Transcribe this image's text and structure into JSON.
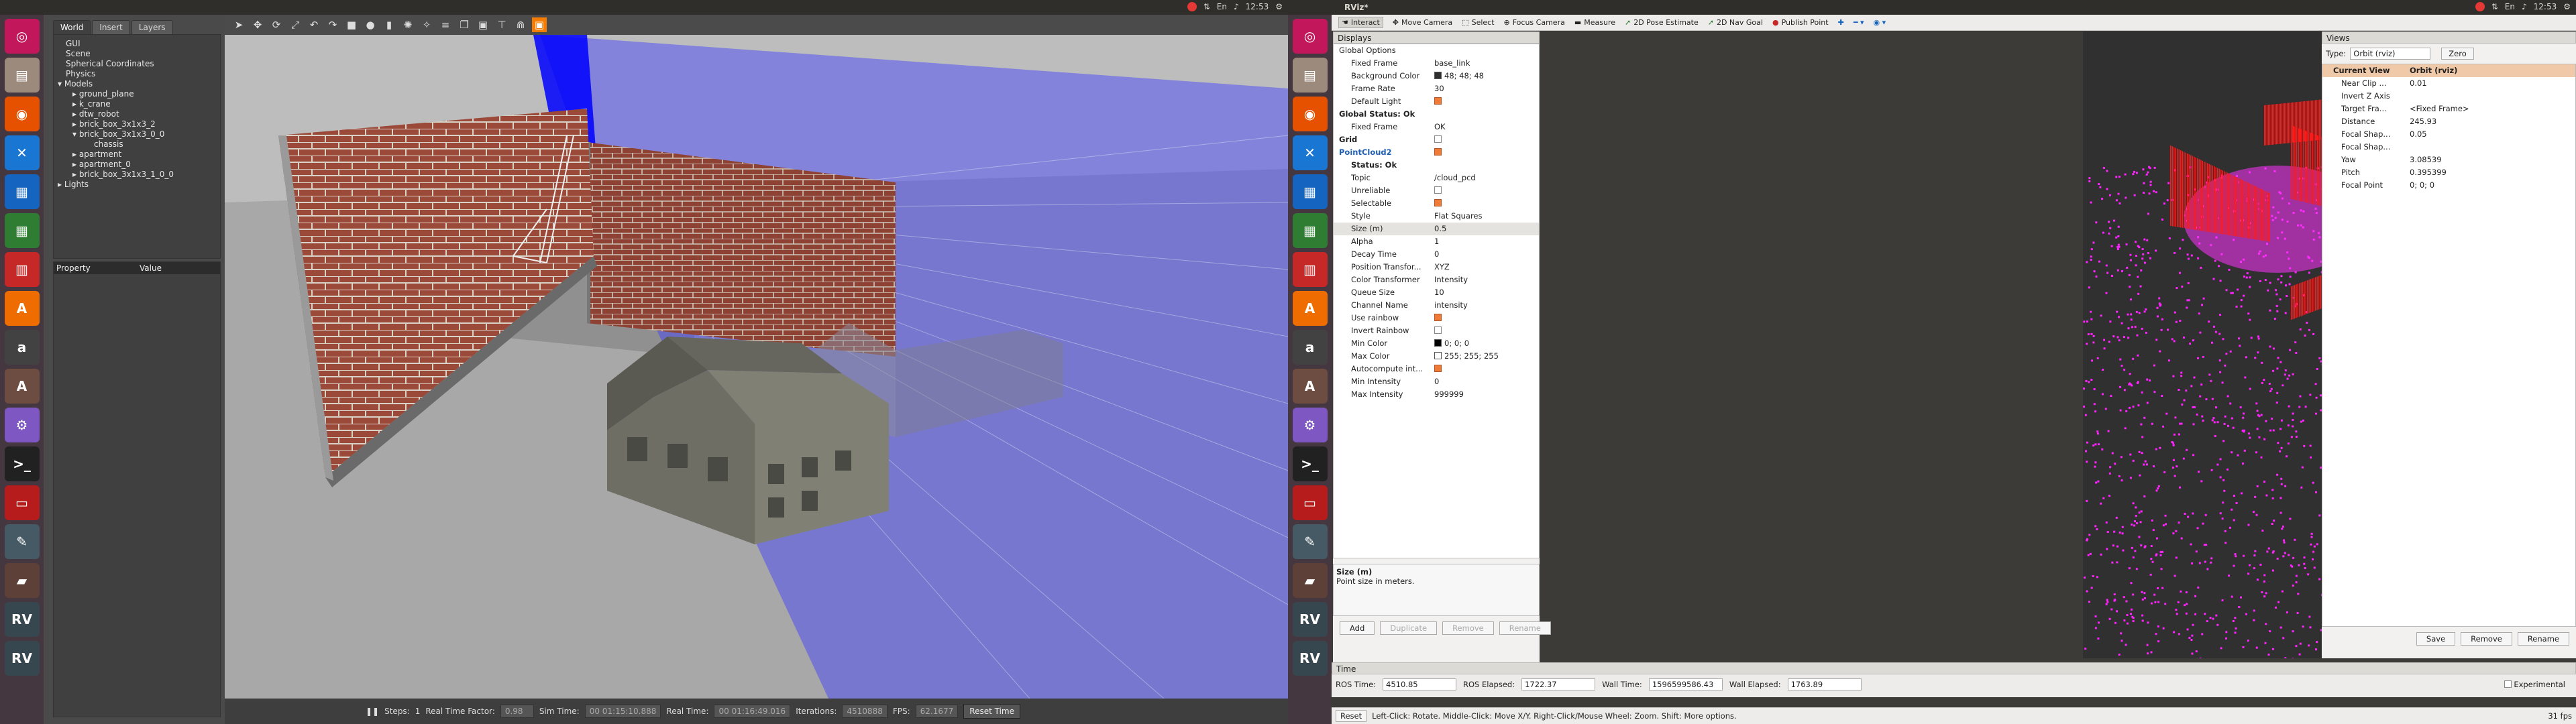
{
  "left_topbar": {
    "title": "",
    "time": "12:53",
    "kbd": "En"
  },
  "right_topbar": {
    "title": "RViz*",
    "time": "12:53",
    "kbd": "En"
  },
  "gazebo": {
    "tabs": [
      "World",
      "Insert",
      "Layers"
    ],
    "tree": [
      "GUI",
      "Scene",
      "Spherical Coordinates",
      "Physics",
      "Models",
      "ground_plane",
      "k_crane",
      "dtw_robot",
      "brick_box_3x1x3_2",
      "brick_box_3x1x3_0_0",
      "chassis",
      "apartment",
      "apartment_0",
      "brick_box_3x1x3_1_0_0",
      "Lights"
    ],
    "prop_headers": [
      "Property",
      "Value"
    ],
    "bottom": {
      "steps_label": "Steps:",
      "steps": "1",
      "rtf_label": "Real Time Factor:",
      "rtf": "0.98",
      "sim_label": "Sim Time:",
      "sim": "00 01:15:10.888",
      "real_label": "Real Time:",
      "real": "00 01:16:49.016",
      "iter_label": "Iterations:",
      "iter": "4510888",
      "fps_label": "FPS:",
      "fps": "62.1677",
      "reset": "Reset Time"
    }
  },
  "rviz": {
    "tools": [
      "Interact",
      "Move Camera",
      "Select",
      "Focus Camera",
      "Measure",
      "2D Pose Estimate",
      "2D Nav Goal",
      "Publish Point"
    ],
    "displays_title": "Displays",
    "rows": [
      {
        "k": "Global Options",
        "v": "",
        "indent": 1,
        "bold": false
      },
      {
        "k": "Fixed Frame",
        "v": "base_link",
        "indent": 2
      },
      {
        "k": "Background Color",
        "v": "48; 48; 48",
        "indent": 2,
        "swatch": "#303030"
      },
      {
        "k": "Frame Rate",
        "v": "30",
        "indent": 2
      },
      {
        "k": "Default Light",
        "v": "",
        "indent": 2,
        "cb": true
      },
      {
        "k": "Global Status: Ok",
        "v": "",
        "indent": 1,
        "bold": true
      },
      {
        "k": "Fixed Frame",
        "v": "OK",
        "indent": 2
      },
      {
        "k": "Grid",
        "v": "",
        "indent": 1,
        "bold": true,
        "cb": false
      },
      {
        "k": "PointCloud2",
        "v": "",
        "indent": 1,
        "blue": true,
        "cb": true
      },
      {
        "k": "Status: Ok",
        "v": "",
        "indent": 2,
        "bold": true
      },
      {
        "k": "Topic",
        "v": "/cloud_pcd",
        "indent": 2
      },
      {
        "k": "Unreliable",
        "v": "",
        "indent": 2,
        "cb": false
      },
      {
        "k": "Selectable",
        "v": "",
        "indent": 2,
        "cb": true
      },
      {
        "k": "Style",
        "v": "Flat Squares",
        "indent": 2
      },
      {
        "k": "Size (m)",
        "v": "0.5",
        "indent": 2,
        "sel": true
      },
      {
        "k": "Alpha",
        "v": "1",
        "indent": 2
      },
      {
        "k": "Decay Time",
        "v": "0",
        "indent": 2
      },
      {
        "k": "Position Transfor...",
        "v": "XYZ",
        "indent": 2
      },
      {
        "k": "Color Transformer",
        "v": "Intensity",
        "indent": 2
      },
      {
        "k": "Queue Size",
        "v": "10",
        "indent": 2
      },
      {
        "k": "Channel Name",
        "v": "intensity",
        "indent": 2
      },
      {
        "k": "Use rainbow",
        "v": "",
        "indent": 2,
        "cb": true
      },
      {
        "k": "Invert Rainbow",
        "v": "",
        "indent": 2,
        "cb": false
      },
      {
        "k": "Min Color",
        "v": "0; 0; 0",
        "indent": 2,
        "swatch": "#000000"
      },
      {
        "k": "Max Color",
        "v": "255; 255; 255",
        "indent": 2,
        "swatch": "#ffffff"
      },
      {
        "k": "Autocompute int...",
        "v": "",
        "indent": 2,
        "cb": true
      },
      {
        "k": "Min Intensity",
        "v": "0",
        "indent": 2
      },
      {
        "k": "Max Intensity",
        "v": "999999",
        "indent": 2
      }
    ],
    "desc_title": "Size (m)",
    "desc_text": "Point size in meters.",
    "disp_buttons": [
      "Add",
      "Duplicate",
      "Remove",
      "Rename"
    ],
    "views_title": "Views",
    "views_type_label": "Type:",
    "views_type": "Orbit (rviz)",
    "views_zero": "Zero",
    "view_rows": [
      {
        "k": "Current View",
        "v": "Orbit (rviz)",
        "bold": true
      },
      {
        "k": "Near Clip ...",
        "v": "0.01"
      },
      {
        "k": "Invert Z Axis",
        "v": ""
      },
      {
        "k": "Target Fra...",
        "v": "<Fixed Frame>"
      },
      {
        "k": "Distance",
        "v": "245.93"
      },
      {
        "k": "Focal Shap...",
        "v": "0.05"
      },
      {
        "k": "Focal Shap...",
        "v": ""
      },
      {
        "k": "Yaw",
        "v": "3.08539"
      },
      {
        "k": "Pitch",
        "v": "0.395399"
      },
      {
        "k": "Focal Point",
        "v": "0; 0; 0"
      }
    ],
    "views_buttons": [
      "Save",
      "Remove",
      "Rename"
    ],
    "time_title": "Time",
    "ros_time_label": "ROS Time:",
    "ros_time": "4510.85",
    "ros_elapsed_label": "ROS Elapsed:",
    "ros_elapsed": "1722.37",
    "wall_time_label": "Wall Time:",
    "wall_time": "1596599586.43",
    "wall_elapsed_label": "Wall Elapsed:",
    "wall_elapsed": "1763.89",
    "experimental": "Experimental",
    "status_reset": "Reset",
    "status_hint": "Left-Click: Rotate. Middle-Click: Move X/Y. Right-Click/Mouse Wheel: Zoom. Shift: More options.",
    "fps": "31 fps"
  },
  "colors": {
    "launcher": "#45373f",
    "rviz_bg": "#303030",
    "brick": "#9b4a3a",
    "cloud_red": "#ff1a1a",
    "cloud_magenta": "#ff22ff"
  }
}
